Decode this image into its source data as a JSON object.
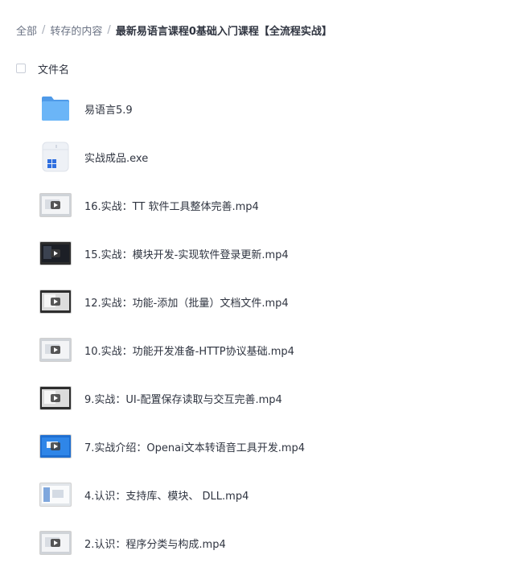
{
  "breadcrumb": {
    "root": "全部",
    "separator": "/",
    "parent": "转存的内容",
    "current": "最新易语言课程0基础入门课程【全流程实战】"
  },
  "list_header": {
    "column_name": "文件名"
  },
  "files": [
    {
      "name": "易语言5.9",
      "icon": "folder-icon"
    },
    {
      "name": "实战成品.exe",
      "icon": "exe-file-icon"
    },
    {
      "name": "16.实战：TT 软件工具整体完善.mp4",
      "icon": "video-thumbnail-icon"
    },
    {
      "name": "15.实战：模块开发-实现软件登录更新.mp4",
      "icon": "video-thumbnail-icon"
    },
    {
      "name": "12.实战：功能-添加（批量）文档文件.mp4",
      "icon": "video-thumbnail-icon"
    },
    {
      "name": "10.实战：功能开发准备-HTTP协议基础.mp4",
      "icon": "video-thumbnail-icon"
    },
    {
      "name": "9.实战：UI-配置保存读取与交互完善.mp4",
      "icon": "video-thumbnail-icon"
    },
    {
      "name": "7.实战介绍：Openai文本转语音工具开发.mp4",
      "icon": "video-thumbnail-icon"
    },
    {
      "name": "4.认识：支持库、模块、 DLL.mp4",
      "icon": "video-thumbnail-icon"
    },
    {
      "name": "2.认识：程序分类与构成.mp4",
      "icon": "video-thumbnail-icon"
    }
  ],
  "colors": {
    "text_primary": "#2f3440",
    "text_secondary": "#6b7384",
    "folder_blue": "#5aa7f2",
    "background": "#ffffff"
  }
}
